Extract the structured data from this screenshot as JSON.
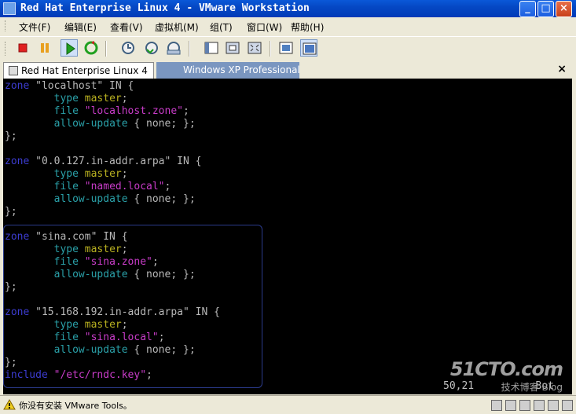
{
  "window": {
    "title": "Red Hat Enterprise Linux 4 - VMware Workstation"
  },
  "titlebar_buttons": {
    "minimize": "_",
    "maximize": "□",
    "close": "×"
  },
  "menu": [
    "文件(F)",
    "编辑(E)",
    "查看(V)",
    "虚拟机(M)",
    "组(T)",
    "窗口(W)",
    "帮助(H)"
  ],
  "toolbar": {
    "icons": [
      "stop-icon",
      "pause-icon",
      "play-icon",
      "reset-icon",
      "snapshot-icon",
      "revert-snapshot-icon",
      "snapshot-manager-icon",
      "sidebar-icon",
      "fullscreen-icon",
      "quick-switch-icon",
      "console-view-icon",
      "summary-view-icon"
    ]
  },
  "tabs": [
    {
      "label": "Red Hat Enterprise Linux 4",
      "active": true
    },
    {
      "label": "Windows XP Professional",
      "active": false
    }
  ],
  "tab_close": "×",
  "terminal": {
    "lines": [
      [
        [
          "kwb",
          "zone"
        ],
        [
          "kw",
          " \"localhost\" IN {"
        ]
      ],
      [
        [
          "kw",
          "        "
        ],
        [
          "teal",
          "type"
        ],
        [
          "kw",
          " "
        ],
        [
          "yel",
          "master"
        ],
        [
          "kw",
          ";"
        ]
      ],
      [
        [
          "kw",
          "        "
        ],
        [
          "teal",
          "file"
        ],
        [
          "kw",
          " "
        ],
        [
          "str",
          "\"localhost.zone\""
        ],
        [
          "kw",
          ";"
        ]
      ],
      [
        [
          "kw",
          "        "
        ],
        [
          "teal",
          "allow-update"
        ],
        [
          "kw",
          " { none; };"
        ]
      ],
      [
        [
          "kw",
          "};"
        ]
      ],
      [
        [
          "kw",
          ""
        ]
      ],
      [
        [
          "kwb",
          "zone"
        ],
        [
          "kw",
          " \"0.0.127.in-addr.arpa\" IN {"
        ]
      ],
      [
        [
          "kw",
          "        "
        ],
        [
          "teal",
          "type"
        ],
        [
          "kw",
          " "
        ],
        [
          "yel",
          "master"
        ],
        [
          "kw",
          ";"
        ]
      ],
      [
        [
          "kw",
          "        "
        ],
        [
          "teal",
          "file"
        ],
        [
          "kw",
          " "
        ],
        [
          "str",
          "\"named.local\""
        ],
        [
          "kw",
          ";"
        ]
      ],
      [
        [
          "kw",
          "        "
        ],
        [
          "teal",
          "allow-update"
        ],
        [
          "kw",
          " { none; };"
        ]
      ],
      [
        [
          "kw",
          "};"
        ]
      ],
      [
        [
          "kw",
          ""
        ]
      ],
      [
        [
          "kwb",
          "zone"
        ],
        [
          "kw",
          " \"sina.com\" IN {"
        ]
      ],
      [
        [
          "kw",
          "        "
        ],
        [
          "teal",
          "type"
        ],
        [
          "kw",
          " "
        ],
        [
          "yel",
          "master"
        ],
        [
          "kw",
          ";"
        ]
      ],
      [
        [
          "kw",
          "        "
        ],
        [
          "teal",
          "file"
        ],
        [
          "kw",
          " "
        ],
        [
          "str",
          "\"sina.zone\""
        ],
        [
          "kw",
          ";"
        ]
      ],
      [
        [
          "kw",
          "        "
        ],
        [
          "teal",
          "allow-update"
        ],
        [
          "kw",
          " { none; };"
        ]
      ],
      [
        [
          "kw",
          "};"
        ]
      ],
      [
        [
          "kw",
          ""
        ]
      ],
      [
        [
          "kwb",
          "zone"
        ],
        [
          "kw",
          " \"15.168.192.in-addr.arpa\" IN {"
        ]
      ],
      [
        [
          "kw",
          "        "
        ],
        [
          "teal",
          "type"
        ],
        [
          "kw",
          " "
        ],
        [
          "yel",
          "master"
        ],
        [
          "kw",
          ";"
        ]
      ],
      [
        [
          "kw",
          "        "
        ],
        [
          "teal",
          "file"
        ],
        [
          "kw",
          " "
        ],
        [
          "str",
          "\"sina.local\""
        ],
        [
          "kw",
          ";"
        ]
      ],
      [
        [
          "kw",
          "        "
        ],
        [
          "teal",
          "allow-update"
        ],
        [
          "kw",
          " { none; };"
        ]
      ],
      [
        [
          "kw",
          "};"
        ]
      ],
      [
        [
          "kwb",
          "include"
        ],
        [
          "kw",
          " "
        ],
        [
          "str",
          "\"/etc/rndc.key\""
        ],
        [
          "kw",
          ";"
        ]
      ]
    ],
    "cursor_position": "50,21",
    "scroll_position": "Bot"
  },
  "watermark": {
    "line1": "51CTO.com",
    "line2": "技术博客 Blog"
  },
  "statusbar": {
    "message": "你没有安装 VMware Tools。"
  },
  "colors": {
    "titlebar": "#0548c4",
    "keyword": "#3c3cd0",
    "option": "#2aa0a8",
    "value": "#b8b020",
    "string": "#c83cc8"
  }
}
